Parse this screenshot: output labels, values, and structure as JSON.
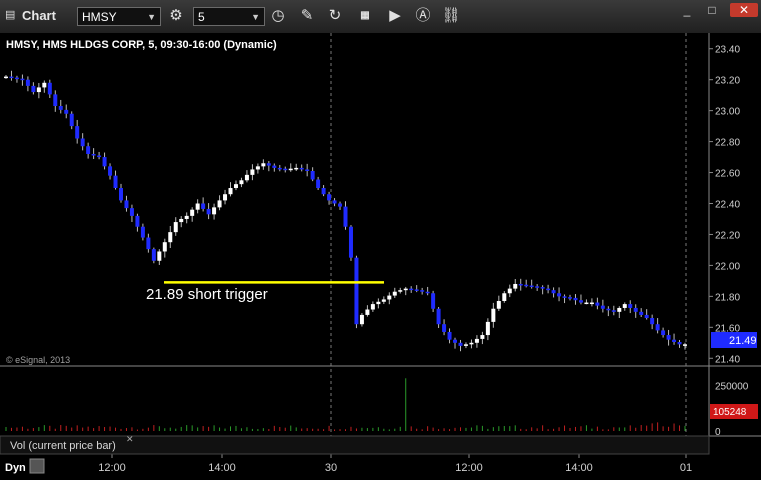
{
  "window": {
    "title": "Chart",
    "symbol": "HMSY",
    "interval": "5",
    "minimize_label": "_",
    "maximize_label": "□",
    "close_label": "✕"
  },
  "toolbar_icons": [
    "chart-icon",
    "dropdown-icon",
    "settings-icon",
    "clock-icon",
    "pencil-icon",
    "refresh-icon",
    "studies-icon",
    "play-icon",
    "annotation-icon",
    "link-icon"
  ],
  "chart_header": "HMSY, HMS HLDGS CORP, 5, 09:30-16:00 (Dynamic)",
  "copyright": "© eSignal, 2013",
  "annotation": {
    "text": "21.89 short trigger",
    "level": 21.89
  },
  "last_price": "21.49",
  "last_volume": "105248",
  "volume_label": "Vol (current price bar)",
  "bottom_label": "Dyn",
  "colors": {
    "up": "#ffffff",
    "down": "#1f2bff",
    "annotation": "#ffff00",
    "last_price_bg": "#1f2bff",
    "volume_badge_bg": "#d01818",
    "volume_up": "#2a9a2a",
    "volume_down": "#c02020",
    "background": "#000000"
  },
  "chart_data": {
    "type": "candlestick",
    "price_axis": {
      "ticks": [
        "23.40",
        "23.20",
        "23.00",
        "22.80",
        "22.60",
        "22.40",
        "22.20",
        "22.00",
        "21.80",
        "21.60",
        "21.40"
      ],
      "ylim": [
        21.35,
        23.45
      ]
    },
    "volume_axis": {
      "ticks": [
        "250000",
        "0"
      ],
      "ylim": [
        0,
        330000
      ]
    },
    "time_axis": {
      "ticks": [
        "12:00",
        "14:00",
        "30",
        "12:00",
        "14:00",
        "01"
      ]
    },
    "close_path": [
      [
        0,
        23.22
      ],
      [
        3,
        23.2
      ],
      [
        5,
        23.12
      ],
      [
        7,
        23.18
      ],
      [
        9,
        23.03
      ],
      [
        11,
        22.98
      ],
      [
        13,
        22.82
      ],
      [
        15,
        22.72
      ],
      [
        17,
        22.7
      ],
      [
        19,
        22.58
      ],
      [
        21,
        22.42
      ],
      [
        23,
        22.32
      ],
      [
        25,
        22.18
      ],
      [
        27,
        22.03
      ],
      [
        29,
        22.15
      ],
      [
        31,
        22.28
      ],
      [
        33,
        22.32
      ],
      [
        35,
        22.4
      ],
      [
        37,
        22.33
      ],
      [
        39,
        22.42
      ],
      [
        41,
        22.5
      ],
      [
        43,
        22.55
      ],
      [
        45,
        22.62
      ],
      [
        47,
        22.66
      ],
      [
        49,
        22.63
      ],
      [
        51,
        22.62
      ],
      [
        53,
        22.63
      ],
      [
        55,
        22.61
      ],
      [
        57,
        22.5
      ],
      [
        59,
        22.42
      ],
      [
        61,
        22.38
      ],
      [
        62,
        22.25
      ],
      [
        63,
        22.05
      ],
      [
        64,
        21.62
      ],
      [
        65,
        21.68
      ],
      [
        67,
        21.75
      ],
      [
        69,
        21.78
      ],
      [
        71,
        21.83
      ],
      [
        73,
        21.85
      ],
      [
        75,
        21.84
      ],
      [
        77,
        21.82
      ],
      [
        79,
        21.62
      ],
      [
        81,
        21.52
      ],
      [
        83,
        21.48
      ],
      [
        85,
        21.5
      ],
      [
        87,
        21.55
      ],
      [
        89,
        21.72
      ],
      [
        91,
        21.82
      ],
      [
        93,
        21.88
      ],
      [
        95,
        21.87
      ],
      [
        97,
        21.86
      ],
      [
        99,
        21.84
      ],
      [
        101,
        21.8
      ],
      [
        103,
        21.79
      ],
      [
        105,
        21.76
      ],
      [
        107,
        21.76
      ],
      [
        109,
        21.72
      ],
      [
        111,
        21.7
      ],
      [
        113,
        21.75
      ],
      [
        115,
        21.7
      ],
      [
        117,
        21.66
      ],
      [
        119,
        21.58
      ],
      [
        121,
        21.52
      ],
      [
        123,
        21.49
      ],
      [
        124,
        21.49
      ]
    ],
    "volume_spike_index": 73,
    "volume_spike_value": 290000
  }
}
